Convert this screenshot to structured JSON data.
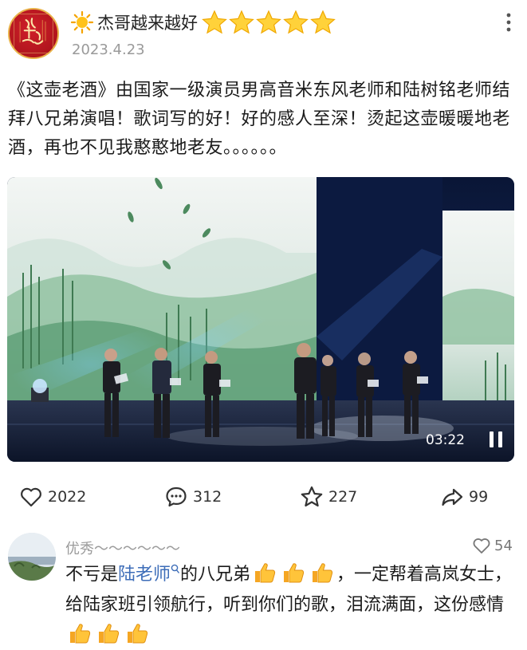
{
  "author": {
    "name": "杰哥越来越好",
    "avatar_icon": "calligraphy-seal-avatar",
    "date": "2023.4.23",
    "star_count": 5
  },
  "post": {
    "text": "《这壶老酒》由国家一级演员男高音米东风老师和陆树铭老师结拜八兄弟演唱！歌词写的好！好的感人至深！烫起这壶暖暖地老酒，再也不见我憨憨地老友。。。。。。"
  },
  "video": {
    "time": "03:22",
    "state": "playing"
  },
  "actions": {
    "likes": "2022",
    "comments": "312",
    "favorites": "227",
    "shares": "99"
  },
  "comment": {
    "user": "优秀～～～～～～",
    "likes": "54",
    "text_before": "不亏是",
    "link": "陆老师",
    "text_mid": "的八兄弟",
    "text_after": "，一定帮着高岚女士，给陆家班引领航行，听到你们的歌，泪流满面，这份感情"
  },
  "colors": {
    "star": "#f4b400",
    "link": "#3d6db8",
    "thumb": "#f5a623"
  }
}
